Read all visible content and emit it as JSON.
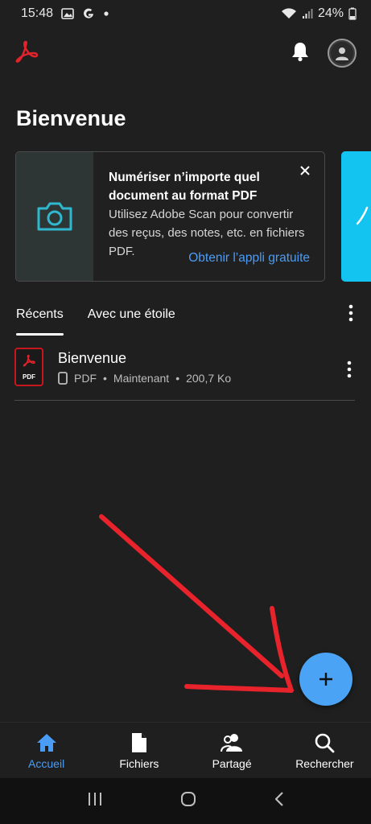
{
  "status_bar": {
    "time": "15:48",
    "battery": "24%",
    "icons": [
      "gallery-icon",
      "google-icon",
      "dot-icon",
      "wifi-icon",
      "signal-icon",
      "battery-icon"
    ]
  },
  "app_bar": {
    "logo": "acrobat-logo-icon",
    "notification_icon": "bell-icon",
    "profile_icon": "avatar-icon"
  },
  "page_title": "Bienvenue",
  "promo": {
    "title": "Numériser n’importe quel document au format PDF",
    "description": "Utilisez Adobe Scan pour convertir des reçus, des notes, etc. en fichiers PDF.",
    "link": "Obtenir l’appli gratuite",
    "icon": "camera-icon",
    "close_icon": "close-icon",
    "next_card_icon": "signature-icon"
  },
  "tabs": [
    {
      "label": "Récents",
      "active": true
    },
    {
      "label": "Avec une étoile",
      "active": false
    }
  ],
  "files": [
    {
      "name": "Bienvenue",
      "type": "PDF",
      "modified": "Maintenant",
      "size": "200,7 Ko",
      "device_icon": "phone-icon",
      "file_icon_label": "PDF"
    }
  ],
  "meta_separator": "•",
  "fab": {
    "icon": "plus-icon",
    "label": "+"
  },
  "bottom_nav": [
    {
      "label": "Accueil",
      "icon": "home-icon",
      "active": true
    },
    {
      "label": "Fichiers",
      "icon": "file-icon",
      "active": false
    },
    {
      "label": "Partagé",
      "icon": "people-icon",
      "active": false
    },
    {
      "label": "Rechercher",
      "icon": "search-icon",
      "active": false
    }
  ],
  "system_nav": [
    "recents-icon",
    "home-circle-icon",
    "back-icon"
  ],
  "colors": {
    "background": "#1f1f1f",
    "accent": "#4b9cf5",
    "fab": "#4aa3f4",
    "acrobat_red": "#e3232b",
    "annotation_red": "#e8232b",
    "promo_next": "#13c3f0"
  }
}
